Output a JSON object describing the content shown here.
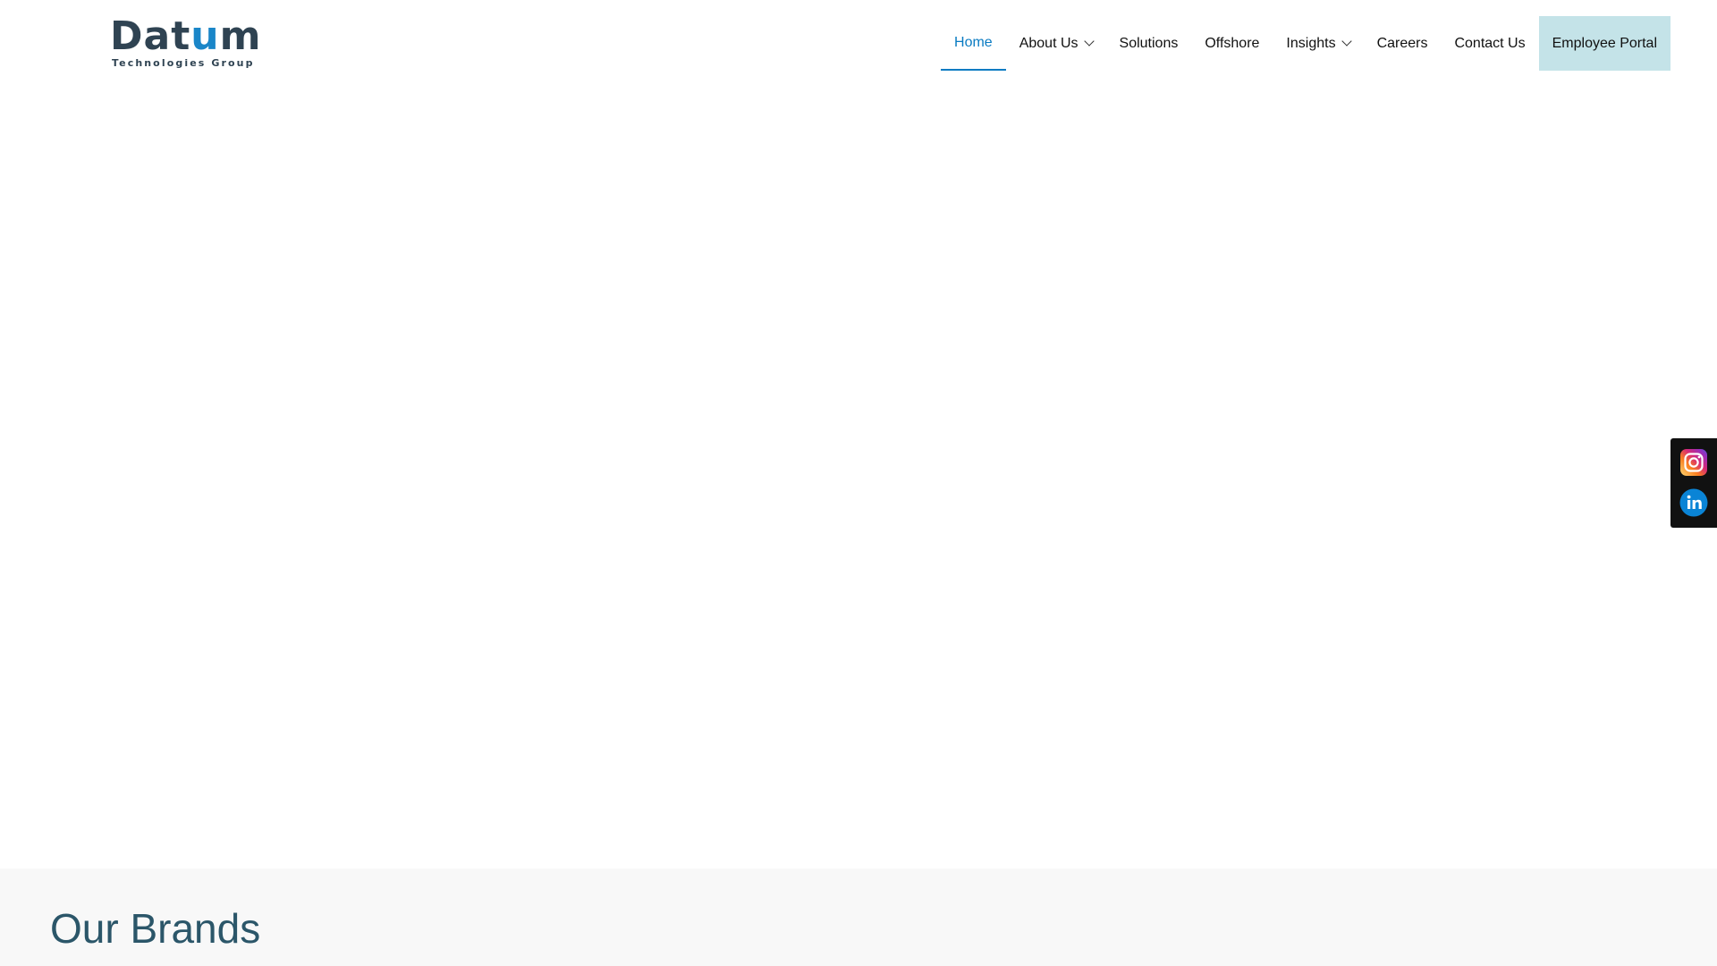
{
  "brand": {
    "name": "Datum",
    "tagline": "Technologies Group",
    "colors": {
      "dark": "#2f4352",
      "accent": "#1a86c8"
    }
  },
  "nav": {
    "items": [
      {
        "label": "Home",
        "active": true
      },
      {
        "label": "About Us",
        "has_dropdown": true
      },
      {
        "label": "Solutions"
      },
      {
        "label": "Offshore"
      },
      {
        "label": "Insights",
        "has_dropdown": true
      },
      {
        "label": "Careers"
      },
      {
        "label": "Contact Us"
      }
    ],
    "portal_label": "Employee Portal",
    "active_color": "#0a7bc2",
    "portal_bg": "#c4e3e8"
  },
  "social": {
    "icons": [
      "instagram-icon",
      "linkedin-icon"
    ]
  },
  "brands_section": {
    "title": "Our Brands",
    "title_color": "#2b5669"
  }
}
